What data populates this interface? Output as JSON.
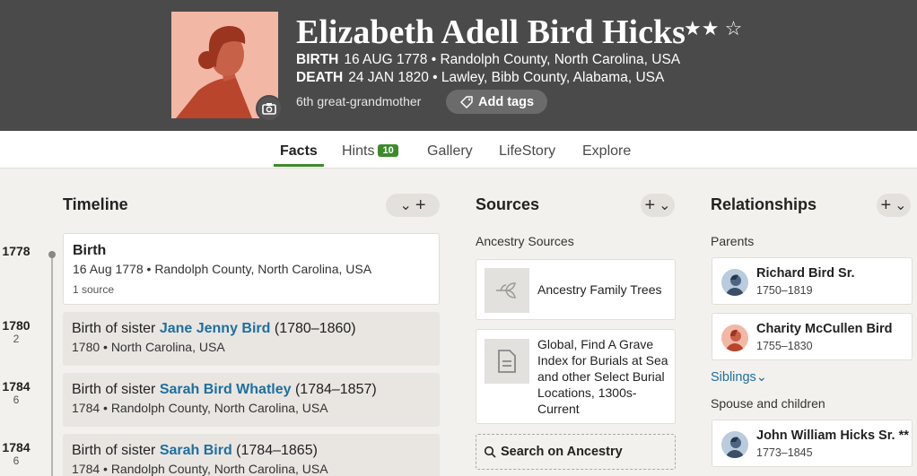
{
  "person": {
    "name": "Elizabeth Adell Bird Hicks",
    "stars": "★★",
    "birth_label": "BIRTH",
    "birth_value": "16 AUG 1778 • Randolph County, North Carolina, USA",
    "death_label": "DEATH",
    "death_value": "24 JAN 1820 • Lawley, Bibb County, Alabama, USA",
    "relation": "6th great-grandmother",
    "add_tags_label": "Add tags"
  },
  "tabs": [
    {
      "label": "Facts"
    },
    {
      "label": "Hints",
      "badge": "10"
    },
    {
      "label": "Gallery"
    },
    {
      "label": "LifeStory"
    },
    {
      "label": "Explore"
    }
  ],
  "timeline": {
    "title": "Timeline",
    "events": [
      {
        "year": "1778",
        "age": "",
        "prefix": "Birth",
        "link": "",
        "suffix": "",
        "detail": "16 Aug 1778 • Randolph County, North Carolina, USA",
        "sources": "1 source"
      },
      {
        "year": "1780",
        "age": "2",
        "prefix": "Birth of sister ",
        "link": "Jane Jenny Bird",
        "suffix": " (1780–1860)",
        "detail": "1780 • North Carolina, USA",
        "sources": ""
      },
      {
        "year": "1784",
        "age": "6",
        "prefix": "Birth of sister ",
        "link": "Sarah Bird Whatley",
        "suffix": " (1784–1857)",
        "detail": "1784 • Randolph County, North Carolina, USA",
        "sources": ""
      },
      {
        "year": "1784",
        "age": "6",
        "prefix": "Birth of sister ",
        "link": "Sarah Bird",
        "suffix": " (1784–1865)",
        "detail": "1784 • Randolph County, North Carolina, USA",
        "sources": ""
      }
    ]
  },
  "sources": {
    "title": "Sources",
    "subheading": "Ancestry Sources",
    "items": [
      {
        "label": "Ancestry Family Trees",
        "icon": "leaf-icon"
      },
      {
        "label": "Global, Find A Grave Index for Burials at Sea and other Select Burial Locations, 1300s-Current",
        "icon": "document-icon"
      }
    ],
    "search_label": "Search on Ancestry"
  },
  "relationships": {
    "title": "Relationships",
    "parents_label": "Parents",
    "parents": [
      {
        "name": "Richard Bird Sr.",
        "dates": "1750–1819",
        "gender": "male"
      },
      {
        "name": "Charity McCullen Bird",
        "dates": "1755–1830",
        "gender": "female"
      }
    ],
    "siblings_label": "Siblings",
    "spouse_label": "Spouse and children",
    "spouses": [
      {
        "name": "John William Hicks Sr. **",
        "dates": "1773–1845",
        "gender": "male"
      }
    ]
  },
  "colors": {
    "header_bg": "#4a4a4a",
    "accent_green": "#3d8a2a",
    "link_blue": "#1f6f9e",
    "female_avatar": "#f2b8a5",
    "male_avatar": "#b9cbdc"
  }
}
